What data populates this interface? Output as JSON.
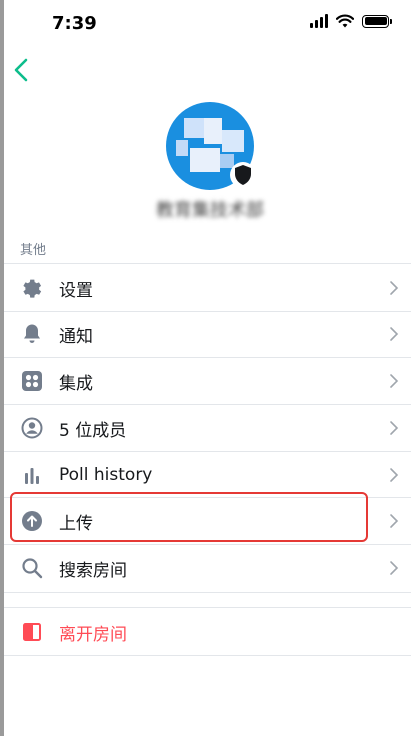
{
  "status_bar": {
    "time": "7:39"
  },
  "room": {
    "name": "教育集技术部"
  },
  "section": {
    "other_label": "其他"
  },
  "menu": {
    "settings": "设置",
    "notifications": "通知",
    "integrations": "集成",
    "members": "5 位成员",
    "poll_history": "Poll history",
    "upload": "上传",
    "search": "搜索房间",
    "leave": "离开房间"
  },
  "colors": {
    "accent": "#0dbd8b",
    "icon": "#737d8c",
    "danger": "#ff4b55",
    "avatar": "#1a8fe0",
    "highlight": "#e53935"
  }
}
